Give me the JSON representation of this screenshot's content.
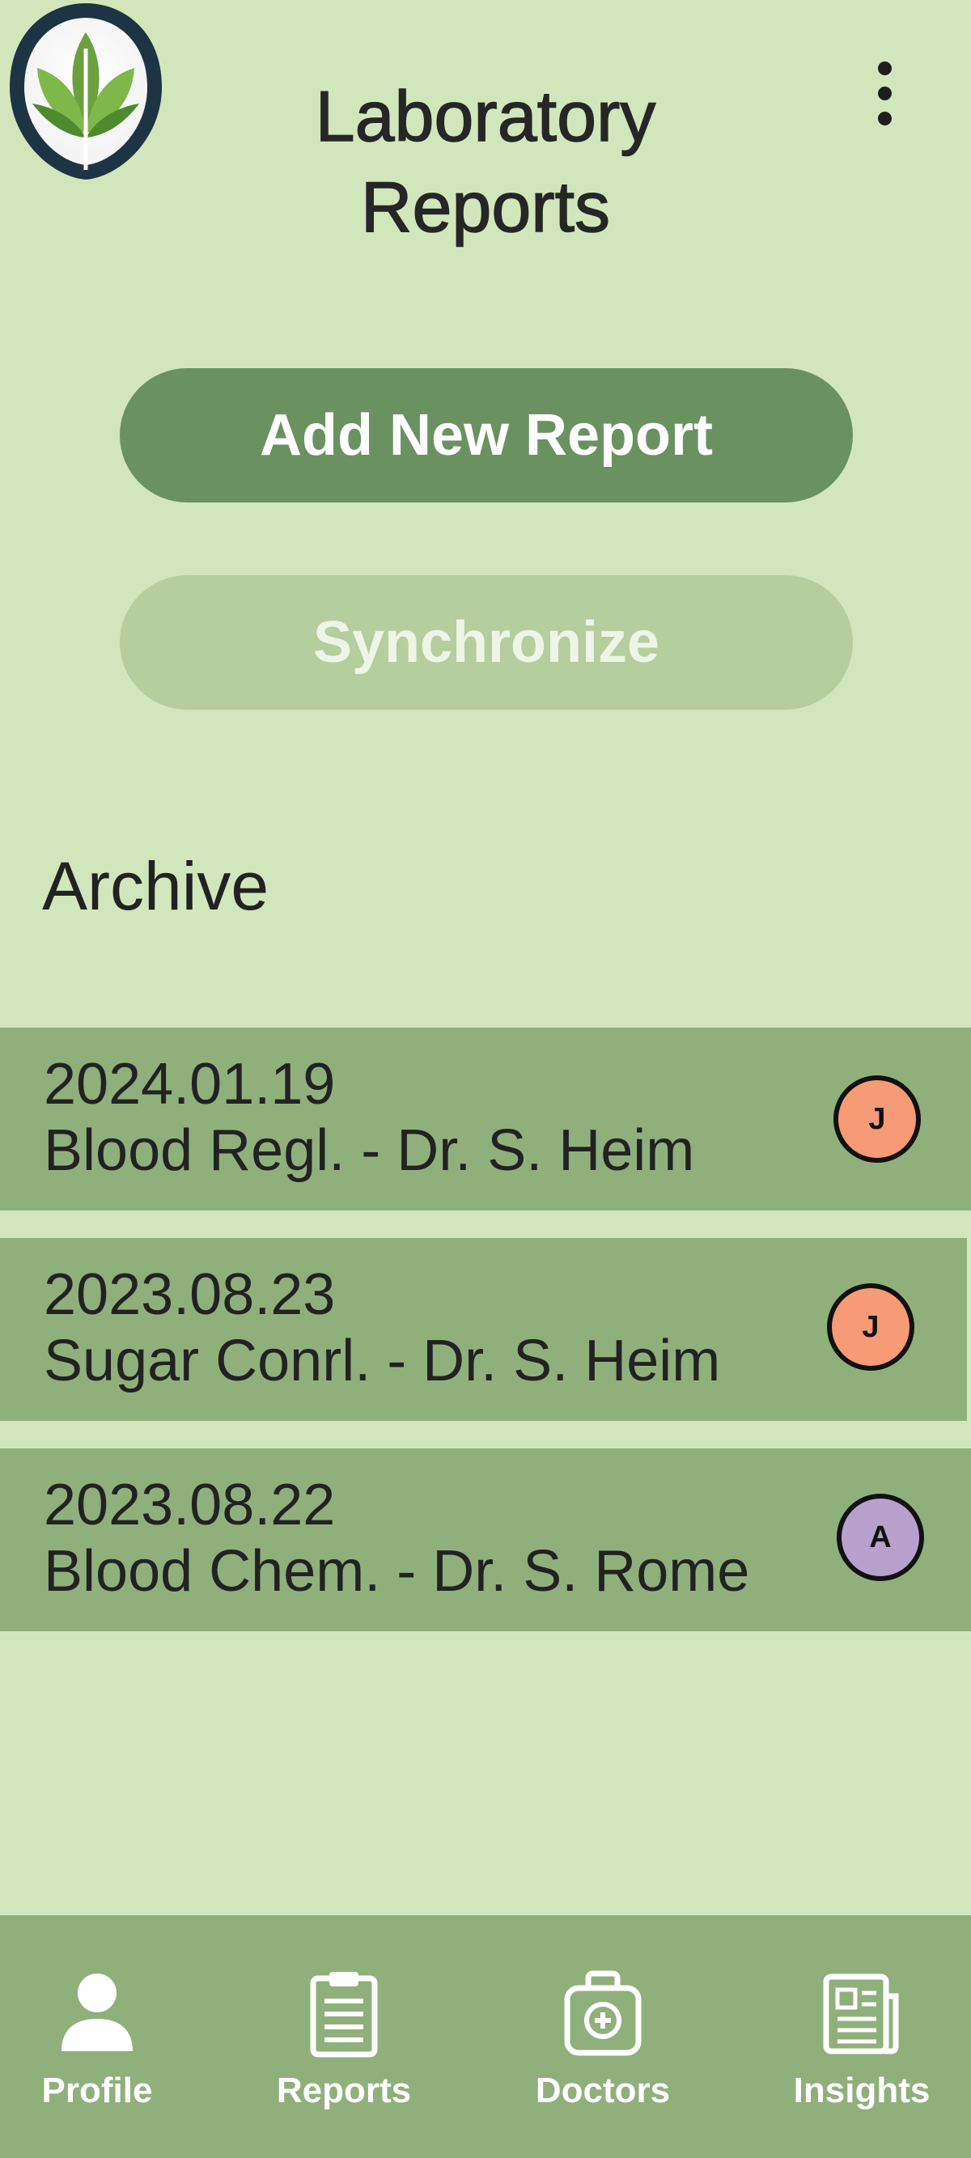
{
  "header": {
    "title": "Laboratory Reports",
    "logo_icon": "leaf-logo-icon",
    "menu_icon": "more-vertical-icon"
  },
  "actions": {
    "add_label": "Add New Report",
    "sync_label": "Synchronize"
  },
  "archive": {
    "heading": "Archive",
    "reports": [
      {
        "date": "2024.01.19",
        "description": "Blood Regl. - Dr. S. Heim",
        "avatar_letter": "J",
        "avatar_color": "#f79a76"
      },
      {
        "date": "2023.08.23",
        "description": "Sugar Conrl. - Dr. S. Heim",
        "avatar_letter": "J",
        "avatar_color": "#f79a76"
      },
      {
        "date": "2023.08.22",
        "description": "Blood Chem. - Dr. S. Rome",
        "avatar_letter": "A",
        "avatar_color": "#b8a0cc"
      }
    ]
  },
  "bottom_nav": {
    "items": [
      {
        "label": "Profile",
        "icon": "person-icon"
      },
      {
        "label": "Reports",
        "icon": "clipboard-icon"
      },
      {
        "label": "Doctors",
        "icon": "medical-kit-icon"
      },
      {
        "label": "Insights",
        "icon": "newspaper-icon"
      }
    ]
  },
  "colors": {
    "background": "#d2e6bb",
    "primary_button": "#6a9260",
    "secondary_button": "#b6cd9e",
    "row_background": "#8fb07b",
    "nav_background": "#8fb07b"
  }
}
